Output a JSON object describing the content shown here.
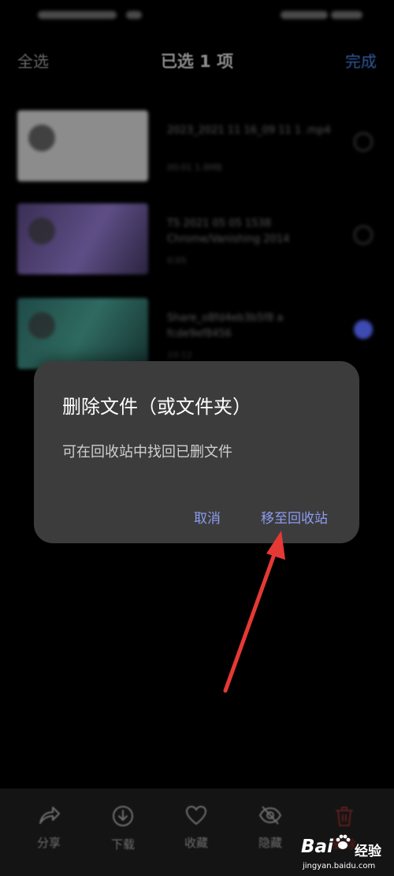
{
  "header": {
    "select_all": "全选",
    "title": "已选 1 项",
    "done": "完成"
  },
  "files": [
    {
      "name": "2023_2021 11 16_09 11 1 .mp4",
      "meta": "00:01 1.8MB",
      "checked": false,
      "thumb_color": "#8c8c8c"
    },
    {
      "name": "TS 2021 05 05 1538 Chrome/Vanishing 2014",
      "meta": "0:05",
      "checked": false,
      "thumb_color": "#4a3d6b"
    },
    {
      "name": "Share_o8fd4eb3b5f8 a fcde9ef8456",
      "meta": "10:12",
      "checked": true,
      "thumb_color": "#1f4a47"
    }
  ],
  "dialog": {
    "title": "删除文件（或文件夹）",
    "message": "可在回收站中找回已删文件",
    "cancel": "取消",
    "confirm": "移至回收站"
  },
  "bottom_bar": {
    "share": "分享",
    "download": "下载",
    "favorite": "收藏",
    "hide": "隐藏",
    "delete": "删除"
  },
  "watermark": {
    "logo": "Bai",
    "logo_suffix": "du",
    "text": "经验",
    "url": "jingyan.baidu.com"
  },
  "colors": {
    "accent": "#8c9cf2",
    "dialog_bg": "#3c3c3c",
    "arrow": "#e53935"
  }
}
